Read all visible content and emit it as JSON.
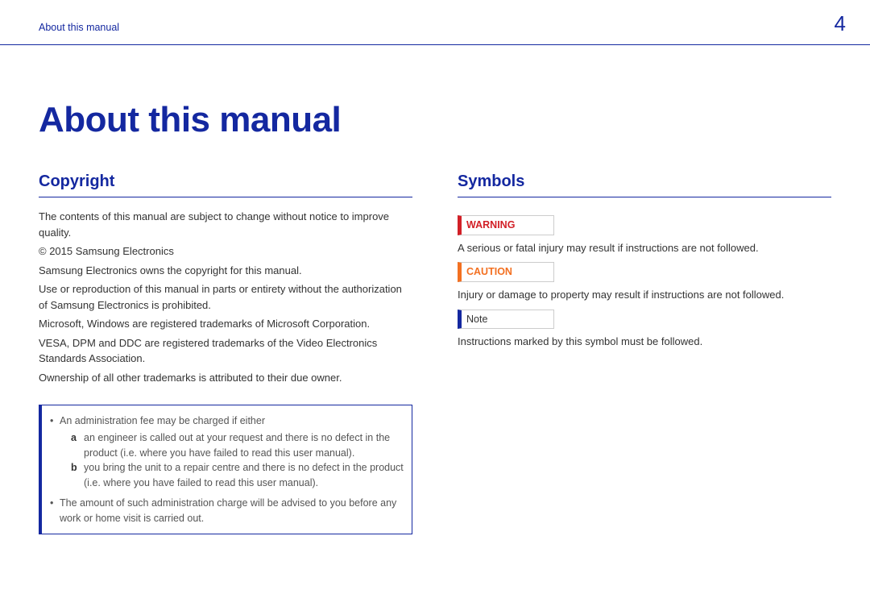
{
  "header": {
    "breadcrumb": "About this manual",
    "page_number": "4"
  },
  "title": "About this manual",
  "left": {
    "heading": "Copyright",
    "paragraphs": [
      "The contents of this manual are subject to change without notice to improve quality.",
      "© 2015 Samsung Electronics",
      "Samsung Electronics owns the copyright for this manual.",
      "Use or reproduction of this manual in parts or entirety without the authorization of Samsung Electronics is prohibited.",
      "Microsoft, Windows are registered trademarks of Microsoft Corporation.",
      "VESA, DPM and DDC are registered trademarks of the Video Electronics Standards Association.",
      "Ownership of all other trademarks is attributed to their due owner."
    ],
    "note_box": {
      "bullet1": "An administration fee may be charged if either",
      "sub_a_marker": "a",
      "sub_a": "an engineer is called out at your request and there is no defect in the product (i.e. where you have failed to read this user manual).",
      "sub_b_marker": "b",
      "sub_b": "you bring the unit to a repair centre and there is no defect in the product (i.e. where you have failed to read this user manual).",
      "bullet2": "The amount of such administration charge will be advised to you before any work or home visit is carried out."
    }
  },
  "right": {
    "heading": "Symbols",
    "warning_label": "WARNING",
    "warning_text": "A serious or fatal injury may result if instructions are not followed.",
    "caution_label": "CAUTION",
    "caution_text": "Injury or damage to property may result if instructions are not followed.",
    "note_label": "Note",
    "note_text": "Instructions marked by this symbol must be followed."
  }
}
